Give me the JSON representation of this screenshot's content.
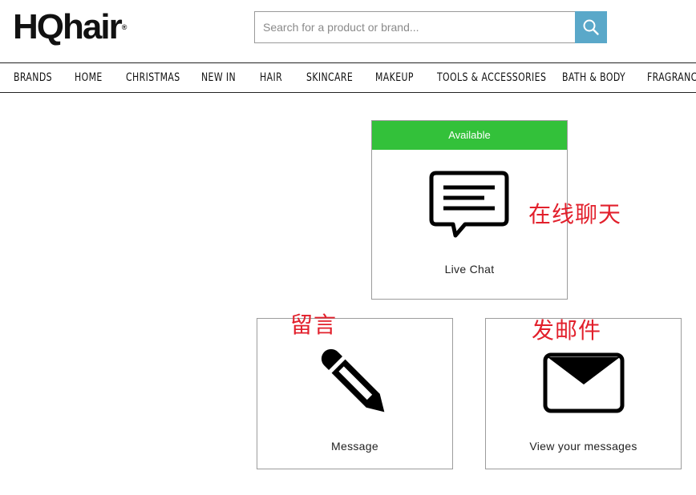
{
  "header": {
    "logo": "HQhair",
    "logo_mark": "®",
    "search_placeholder": "Search for a product or brand..."
  },
  "nav": {
    "items": [
      "BRANDS",
      "HOME",
      "CHRISTMAS",
      "NEW IN",
      "HAIR",
      "SKINCARE",
      "MAKEUP",
      "TOOLS & ACCESSORIES",
      "BATH & BODY",
      "FRAGRANCE"
    ]
  },
  "contact": {
    "live_chat": {
      "status": "Available",
      "label": "Live Chat",
      "status_color": "#33c13a"
    },
    "message": {
      "label": "Message"
    },
    "view_messages": {
      "label": "View your messages"
    }
  },
  "annotations": {
    "live_chat": "在线聊天",
    "message": "留言",
    "email": "发邮件"
  },
  "icons": {
    "search": "search-icon",
    "chat": "chat-bubble-icon",
    "pencil": "pencil-icon",
    "envelope": "envelope-icon"
  },
  "colors": {
    "search_button": "#5aa8c9",
    "annotation": "#e2202c"
  }
}
